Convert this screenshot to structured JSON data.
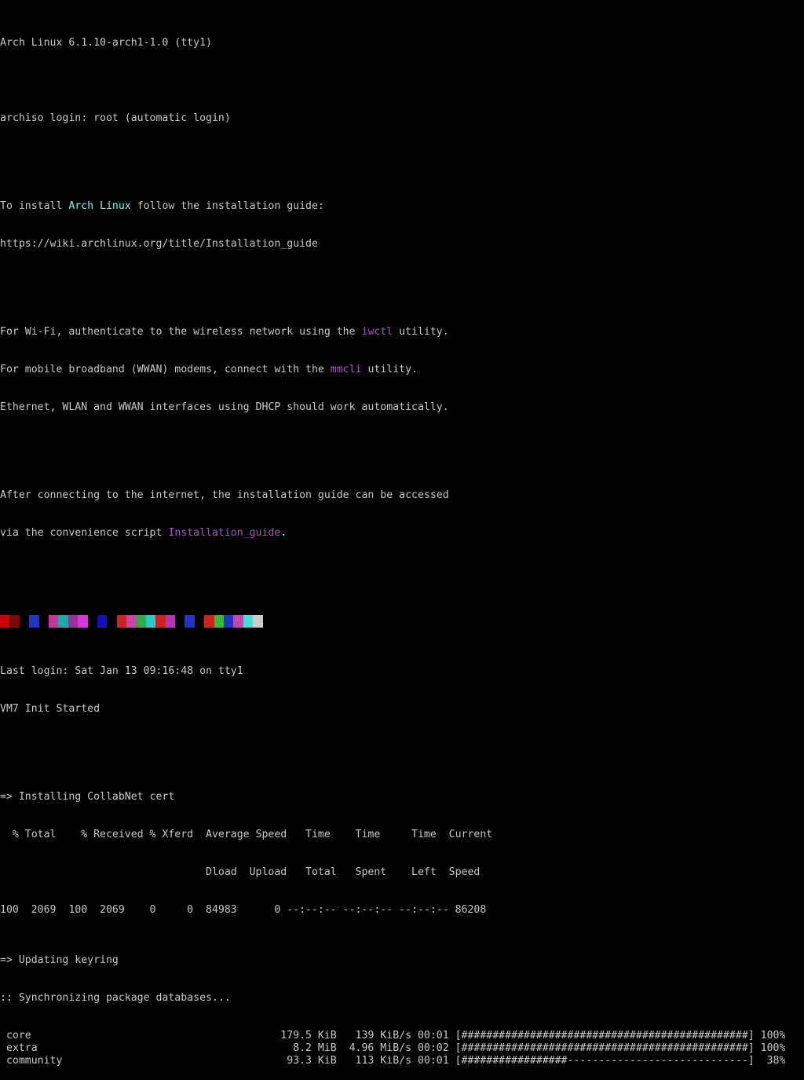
{
  "header": {
    "kernel_line": "Arch Linux 6.1.10-arch1-1.0 (tty1)",
    "login_line": "archiso login: root (automatic login)"
  },
  "install_hint": {
    "prefix": "To install ",
    "distro": "Arch Linux",
    "suffix": " follow the installation guide:",
    "url": "https://wiki.archlinux.org/title/Installation_guide"
  },
  "network_hint": {
    "wifi_prefix": "For Wi-Fi, authenticate to the wireless network using the ",
    "wifi_tool": "iwctl",
    "wifi_suffix": " utility.",
    "wwan_prefix": "For mobile broadband (WWAN) modems, connect with the ",
    "wwan_tool": "mmcli",
    "wwan_suffix": " utility.",
    "dhcp_line": "Ethernet, WLAN and WWAN interfaces using DHCP should work automatically."
  },
  "guide_hint": {
    "line1": "After connecting to the internet, the installation guide can be accessed",
    "line2_prefix": "via the convenience script ",
    "script_name": "Installation_guide",
    "line2_suffix": "."
  },
  "color_band": [
    "#cc0000",
    "#7a0a0a",
    "#000000",
    "#2233cc",
    "#000000",
    "#cc3399",
    "#22aaaa",
    "#993399",
    "#dd33dd",
    "#000000",
    "#1111bb",
    "#000000",
    "#cc2222",
    "#cc44aa",
    "#33aa44",
    "#22cccc",
    "#cc2222",
    "#bb33bb",
    "#000000",
    "#2233cc",
    "#000000",
    "#cc2222",
    "#33bb33",
    "#2233cc",
    "#cc44aa",
    "#44dddd",
    "#cccccc"
  ],
  "session": {
    "last_login": "Last login: Sat Jan 13 09:16:48 on tty1",
    "init": "VM7 Init Started"
  },
  "curl": {
    "title": "=> Installing CollabNet cert",
    "header1": "  % Total    % Received % Xferd  Average Speed   Time    Time     Time  Current",
    "header2": "                                 Dload  Upload   Total   Spent    Left  Speed",
    "row": "100  2069  100  2069    0     0  84983      0 --:--:-- --:--:-- --:--:-- 86208"
  },
  "pacman": {
    "updating": "=> Updating keyring",
    "syncing": ":: Synchronizing package databases...",
    "databases": [
      {
        "name": "core",
        "size": "179.5 KiB",
        "speed": "139 KiB/s",
        "time": "00:01",
        "progress_bar": "[##############################################]",
        "percent": "100%",
        "fraction": 1.0
      },
      {
        "name": "extra",
        "size": "8.2 MiB",
        "speed": "4.96 MiB/s",
        "time": "00:02",
        "progress_bar": "[##############################################]",
        "percent": "100%",
        "fraction": 1.0
      },
      {
        "name": "community",
        "size": "93.3 KiB",
        "speed": "113 KiB/s",
        "time": "00:01",
        "progress_bar": "[#################-----------------------------]",
        "percent": "38%",
        "fraction": 0.38
      }
    ]
  }
}
